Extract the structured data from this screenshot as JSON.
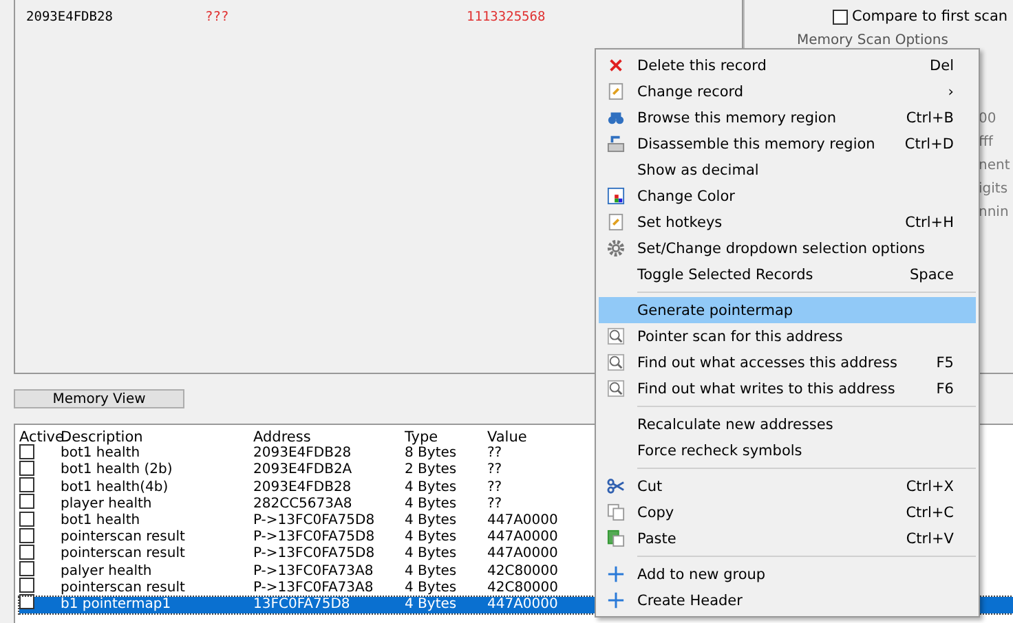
{
  "scan_results": {
    "rows": [
      {
        "address": "2093E4FDB28",
        "value": "???",
        "previous": "1113325568"
      }
    ]
  },
  "scan_options": {
    "compare_first": {
      "label": "Compare to first scan",
      "checked": false
    },
    "group_title": "Memory Scan Options",
    "fragments": [
      "00",
      "fff",
      "nent",
      "igits",
      "nnin"
    ]
  },
  "memory_view_button": "Memory View",
  "table": {
    "columns": [
      "Active",
      "Description",
      "Address",
      "Type",
      "Value"
    ],
    "rows": [
      {
        "active": false,
        "description": "bot1 health",
        "address": "2093E4FDB28",
        "type": "8 Bytes",
        "value": "??",
        "selected": false
      },
      {
        "active": false,
        "description": "bot1 health (2b)",
        "address": "2093E4FDB2A",
        "type": "2 Bytes",
        "value": "??",
        "selected": false
      },
      {
        "active": false,
        "description": "bot1 health(4b)",
        "address": "2093E4FDB28",
        "type": "4 Bytes",
        "value": "??",
        "selected": false
      },
      {
        "active": false,
        "description": "player health",
        "address": "282CC5673A8",
        "type": "4 Bytes",
        "value": "??",
        "selected": false
      },
      {
        "active": false,
        "description": "bot1 health",
        "address": "P->13FC0FA75D8",
        "type": "4 Bytes",
        "value": "447A0000",
        "selected": false
      },
      {
        "active": false,
        "description": "pointerscan result",
        "address": "P->13FC0FA75D8",
        "type": "4 Bytes",
        "value": "447A0000",
        "selected": false
      },
      {
        "active": false,
        "description": "pointerscan result",
        "address": "P->13FC0FA75D8",
        "type": "4 Bytes",
        "value": "447A0000",
        "selected": false
      },
      {
        "active": false,
        "description": "palyer health",
        "address": "P->13FC0FA73A8",
        "type": "4 Bytes",
        "value": "42C80000",
        "selected": false
      },
      {
        "active": false,
        "description": "pointerscan result",
        "address": "P->13FC0FA73A8",
        "type": "4 Bytes",
        "value": "42C80000",
        "selected": false
      },
      {
        "active": false,
        "description": "b1 pointermap1",
        "address": "13FC0FA75D8",
        "type": "4 Bytes",
        "value": "447A0000",
        "selected": true
      }
    ]
  },
  "context_menu": {
    "items": [
      {
        "kind": "item",
        "label": "Delete this record",
        "shortcut": "Del",
        "selected": false
      },
      {
        "kind": "item",
        "label": "Change record",
        "shortcut": "›",
        "selected": false
      },
      {
        "kind": "item",
        "label": "Browse this memory region",
        "shortcut": "Ctrl+B",
        "selected": false
      },
      {
        "kind": "item",
        "label": "Disassemble this memory region",
        "shortcut": "Ctrl+D",
        "selected": false
      },
      {
        "kind": "item",
        "label": "Show as decimal",
        "selected": false
      },
      {
        "kind": "item",
        "label": "Change Color",
        "selected": false
      },
      {
        "kind": "item",
        "label": "Set hotkeys",
        "shortcut": "Ctrl+H",
        "selected": false
      },
      {
        "kind": "item",
        "label": "Set/Change dropdown selection options",
        "selected": false
      },
      {
        "kind": "item",
        "label": "Toggle Selected Records",
        "shortcut": "Space",
        "selected": false
      },
      {
        "kind": "separator"
      },
      {
        "kind": "item",
        "label": "Generate pointermap",
        "selected": true
      },
      {
        "kind": "item",
        "label": "Pointer scan for this address",
        "selected": false
      },
      {
        "kind": "item",
        "label": "Find out what accesses this address",
        "shortcut": "F5",
        "selected": false
      },
      {
        "kind": "item",
        "label": "Find out what writes to this address",
        "shortcut": "F6",
        "selected": false
      },
      {
        "kind": "separator"
      },
      {
        "kind": "item",
        "label": "Recalculate new addresses",
        "selected": false
      },
      {
        "kind": "item",
        "label": "Force recheck symbols",
        "selected": false
      },
      {
        "kind": "separator"
      },
      {
        "kind": "item",
        "label": "Cut",
        "shortcut": "Ctrl+X",
        "selected": false
      },
      {
        "kind": "item",
        "label": "Copy",
        "shortcut": "Ctrl+C",
        "selected": false
      },
      {
        "kind": "item",
        "label": "Paste",
        "shortcut": "Ctrl+V",
        "selected": false
      },
      {
        "kind": "separator"
      },
      {
        "kind": "item",
        "label": "Add to new group",
        "selected": false
      },
      {
        "kind": "item",
        "label": "Create Header",
        "selected": false
      }
    ]
  }
}
